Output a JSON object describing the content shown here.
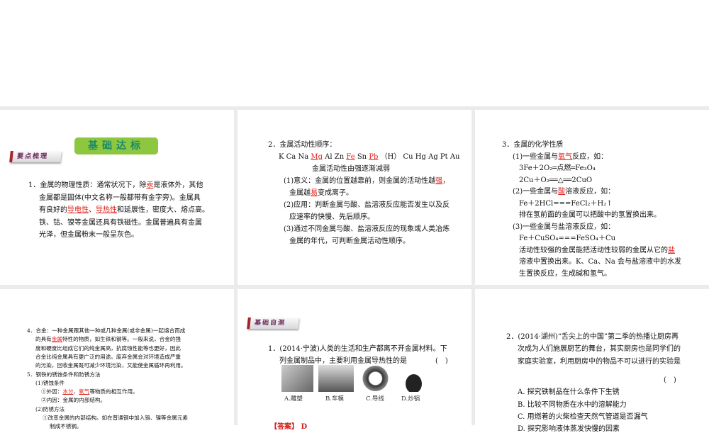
{
  "banner": "基础达标",
  "tag1": "要点梳理",
  "tag2": "基础自测",
  "p1": [
    [
      [
        "1．金属的物理性质：通常状况下，除"
      ],
      [
        "汞",
        1
      ],
      [
        "是液体外，其他"
      ]
    ],
    [
      [
        "金属都是固体(中文名称一般都带有金字旁)。金属具"
      ]
    ],
    [
      [
        "有良好的"
      ],
      [
        "导电性",
        1
      ],
      [
        "、"
      ],
      [
        "导热性",
        1
      ],
      [
        "和延展性，密度大、熔点高。"
      ]
    ],
    [
      [
        "铁、钴、镍等金属还具有铁磁性。金属普遍具有金属"
      ]
    ],
    [
      [
        "光泽，但金属粉末一般呈灰色。"
      ]
    ]
  ],
  "p2": [
    [
      [
        "2．金属活动性顺序："
      ]
    ],
    [
      [
        "K Ca Na "
      ],
      [
        "Mg",
        1
      ],
      [
        " Al Zn "
      ],
      [
        "Fe",
        1
      ],
      [
        " Sn "
      ],
      [
        "Pb",
        1
      ],
      [
        " （H） Cu Hg Ag Pt Au"
      ]
    ],
    [
      [
        "金属活动性由强逐渐减弱"
      ]
    ],
    [
      [
        "(1)意义：金属的位置越靠前，则金属的活动性越"
      ],
      [
        "强",
        1
      ],
      [
        "，"
      ]
    ],
    [
      [
        "金属越"
      ],
      [
        "易",
        1
      ],
      [
        "变成离子。"
      ]
    ],
    [
      [
        "(2)应用：判断金属与酸、盐溶液反应能否发生以及反"
      ]
    ],
    [
      [
        "应速率的快慢、先后顺序。"
      ]
    ],
    [
      [
        "(3)通过不同金属与酸、盐溶液反应的现象或人类冶炼"
      ]
    ],
    [
      [
        "金属的年代，可判断金属活动性顺序。"
      ]
    ]
  ],
  "p3": [
    [
      [
        "3．金属的化学性质"
      ]
    ],
    [
      [
        "(1)一些金属与"
      ],
      [
        "氧气",
        1
      ],
      [
        "反应，如："
      ]
    ],
    [
      [
        "3Fe＋2O₂═点燃═Fe₃O₄"
      ]
    ],
    [
      [
        "2Cu＋O₂══△══2CuO"
      ]
    ],
    [
      [
        "(2)一些金属与"
      ],
      [
        "酸",
        1
      ],
      [
        "溶液反应，如："
      ]
    ],
    [
      [
        "Fe＋2HCl===FeCl₂＋H₂↑"
      ]
    ],
    [
      [
        "排在氢前面的金属可以把酸中的氢置换出来。"
      ]
    ],
    [
      [
        "(3)一些金属与盐溶液反应，如："
      ]
    ],
    [
      [
        "Fe＋CuSO₄===FeSO₄＋Cu"
      ]
    ],
    [
      [
        "活动性较强的金属能把活动性较弱的金属从它的"
      ],
      [
        "盐",
        1
      ]
    ],
    [
      [
        "溶液中置换出来。K、Ca、Na 会与盐溶液中的水发"
      ]
    ],
    [
      [
        "生置换反应，生成碱和氢气。"
      ]
    ]
  ],
  "p4": [
    [
      [
        "4．合金：一种金属跟其他一种或几种金属(或非金属)一起熔合而成"
      ]
    ],
    [
      [
        "的具有"
      ],
      [
        "金属",
        1
      ],
      [
        "特性的物质，如生铁和钢等。一般来说，合金的强"
      ]
    ],
    [
      [
        "度和硬度比组成它们的纯金属高，抗腐蚀性能等也更好，因此"
      ]
    ],
    [
      [
        "合金比纯金属具有更广泛的用途。废弃金属会对环境造成严重"
      ]
    ],
    [
      [
        "的污染，回收金属既可减少环境污染，又能使金属循环再利用。"
      ]
    ],
    [
      [
        "5．钢铁的锈蚀条件和防锈方法"
      ]
    ],
    [
      [
        "(1)锈蚀条件"
      ]
    ],
    [
      [
        "①外因："
      ],
      [
        "水分",
        1
      ],
      [
        "、"
      ],
      [
        "氧气",
        1
      ],
      [
        "等物质的相互作用。"
      ]
    ],
    [
      [
        "②内因：金属的内部结构。"
      ]
    ],
    [
      [
        "(2)防锈方法"
      ]
    ],
    [
      [
        "①改变金属的内部结构。如在普通钢中加入铬、镍等金属元素"
      ]
    ],
    [
      [
        "制成不锈钢。"
      ]
    ]
  ],
  "p5": [
    [
      [
        "1．(2014·宁波)人类的生活和生产都离不开金属材料。下"
      ]
    ],
    [
      [
        "列金属制品中，主要利用金属导热性的是　　　　(　)"
      ]
    ]
  ],
  "options": [
    "A.雕塑",
    "B.车模",
    "C.导线",
    "D.炒锅"
  ],
  "answer": "【答案】 D",
  "p6": [
    [
      [
        "2．(2014·湖州)“舌尖上的中国”第二季的热播让厨房再"
      ]
    ],
    [
      [
        "次成为人们施展厨艺的舞台，其实厨房也是同学们的"
      ]
    ],
    [
      [
        "家庭实验室，利用厨房中的物品不可以进行的实验是"
      ]
    ],
    [
      [
        "(　)"
      ]
    ],
    [
      [
        "A. 探究铁制品在什么条件下生锈"
      ]
    ],
    [
      [
        "B. 比较不同物质在水中的溶解能力"
      ]
    ],
    [
      [
        "C. 用燃着的火柴检查天然气管道是否漏气"
      ]
    ],
    [
      [
        "D. 探究影响液体蒸发快慢的因素"
      ]
    ]
  ],
  "colors": {
    "highlight": "#e0201c",
    "banner": "#8dc63f",
    "band": "#ebebeb"
  }
}
